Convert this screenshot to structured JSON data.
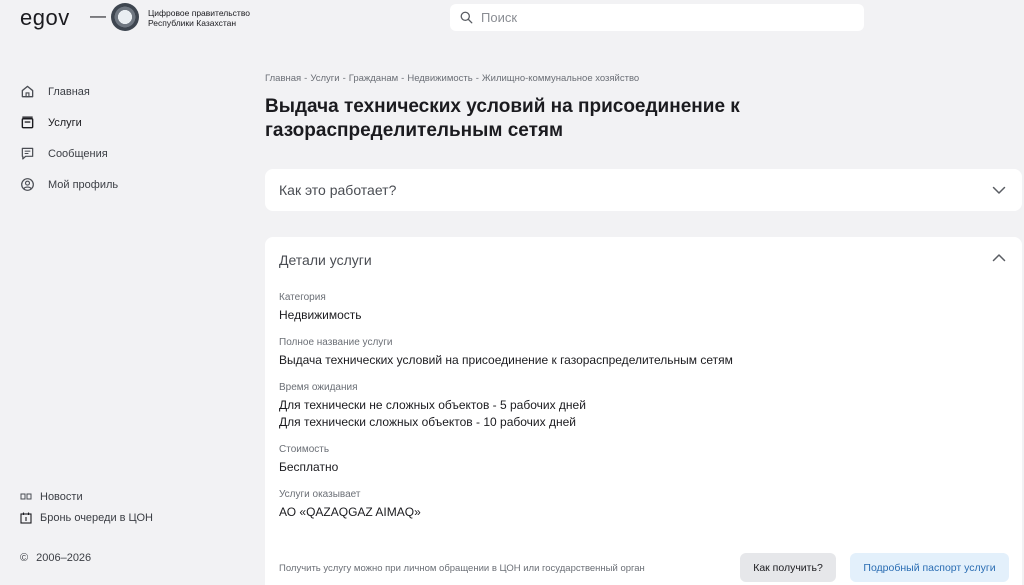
{
  "header": {
    "logo": "egov",
    "dash": "—",
    "gov_line1": "Цифровое правительство",
    "gov_line2": "Республики Казахстан",
    "search_placeholder": "Поиск"
  },
  "sidebar": {
    "items": [
      {
        "label": "Главная",
        "icon": "home-icon"
      },
      {
        "label": "Услуги",
        "icon": "services-icon"
      },
      {
        "label": "Сообщения",
        "icon": "messages-icon"
      },
      {
        "label": "Мой профиль",
        "icon": "profile-icon"
      }
    ],
    "bottom": [
      {
        "label": "Новости",
        "icon": "news-icon"
      },
      {
        "label": "Бронь очереди в ЦОН",
        "icon": "calendar-icon"
      }
    ],
    "copyright_symbol": "©",
    "copyright": "2006–2026"
  },
  "breadcrumb": [
    "Главная",
    "Услуги",
    "Гражданам",
    "Недвижимость",
    "Жилищно-коммунальное хозяйство"
  ],
  "breadcrumb_sep": "-",
  "title": "Выдача технических условий на присоединение к газораспределительным сетям",
  "how_it_works": {
    "title": "Как это работает?"
  },
  "details": {
    "title": "Детали услуги",
    "category_label": "Категория",
    "category": "Недвижимость",
    "full_name_label": "Полное название услуги",
    "full_name": "Выдача технических условий на присоединение к газораспределительным сетям",
    "wait_label": "Время ожидания",
    "wait_line1": "Для технически не сложных объектов - 5 рабочих дней",
    "wait_line2": "Для технически сложных объектов - 10 рабочих дней",
    "cost_label": "Стоимость",
    "cost": "Бесплатно",
    "provider_label": "Услуги оказывает",
    "provider": "АО «QAZAQGAZ AIMAQ»",
    "footer_note": "Получить услугу можно при личном обращении в ЦОН или государственный орган",
    "btn_how": "Как получить?",
    "btn_passport": "Подробный паспорт услуги"
  },
  "colors": {
    "background": "#f2f2f4",
    "card": "#ffffff",
    "passport_button": "#e3f0fb",
    "passport_text": "#2a6db3",
    "secondary_button": "#e6e7ea"
  }
}
